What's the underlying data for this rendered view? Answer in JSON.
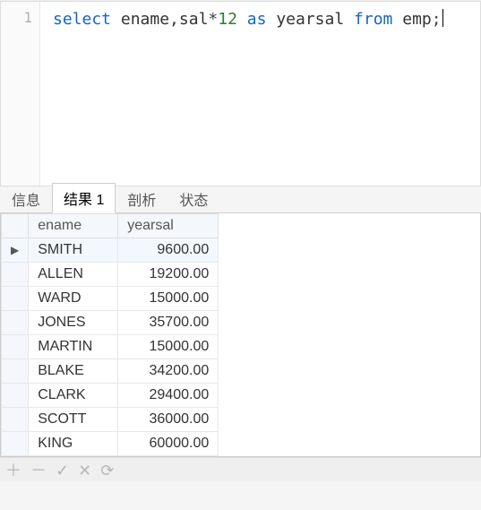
{
  "editor": {
    "line_number": "1",
    "tokens": {
      "select": "select",
      "fields": "ename,sal",
      "star": "*",
      "lit12": "12",
      "as": "as",
      "alias": "yearsal",
      "from": "from",
      "table": "emp",
      "semi": ";"
    }
  },
  "tabs": [
    {
      "label": "信息",
      "active": false
    },
    {
      "label": "结果 1",
      "active": true
    },
    {
      "label": "剖析",
      "active": false
    },
    {
      "label": "状态",
      "active": false
    }
  ],
  "results": {
    "columns": [
      "ename",
      "yearsal"
    ],
    "rows": [
      {
        "ename": "SMITH",
        "yearsal": "9600.00",
        "current": true
      },
      {
        "ename": "ALLEN",
        "yearsal": "19200.00",
        "current": false
      },
      {
        "ename": "WARD",
        "yearsal": "15000.00",
        "current": false
      },
      {
        "ename": "JONES",
        "yearsal": "35700.00",
        "current": false
      },
      {
        "ename": "MARTIN",
        "yearsal": "15000.00",
        "current": false
      },
      {
        "ename": "BLAKE",
        "yearsal": "34200.00",
        "current": false
      },
      {
        "ename": "CLARK",
        "yearsal": "29400.00",
        "current": false
      },
      {
        "ename": "SCOTT",
        "yearsal": "36000.00",
        "current": false
      },
      {
        "ename": "KING",
        "yearsal": "60000.00",
        "current": false
      }
    ]
  },
  "footer": {
    "icons": [
      "plus-icon",
      "minus-icon",
      "check-icon",
      "cross-icon",
      "refresh-icon"
    ],
    "glyphs": {
      "plus-icon": "＋",
      "minus-icon": "－",
      "check-icon": "✓",
      "cross-icon": "✕",
      "refresh-icon": "⟳"
    }
  }
}
